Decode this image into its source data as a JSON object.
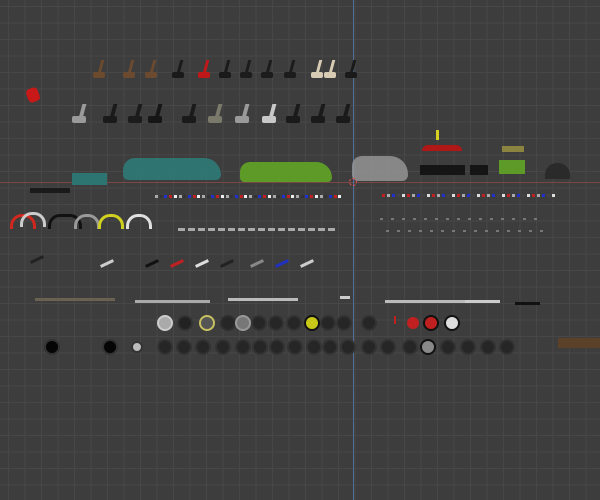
{
  "viewport": {
    "background_color": "#3d3d3d",
    "grid_color": "#474747",
    "x_axis_color": "#7a4646",
    "y_axis_color": "#4f6f9a"
  },
  "objects": {
    "seats": "seat-objects",
    "bodies": "car-body-objects",
    "fenders": "fender-objects",
    "suspension": "suspension-objects",
    "wheels": "wheel-objects",
    "cursor": "3d-cursor-icon"
  }
}
